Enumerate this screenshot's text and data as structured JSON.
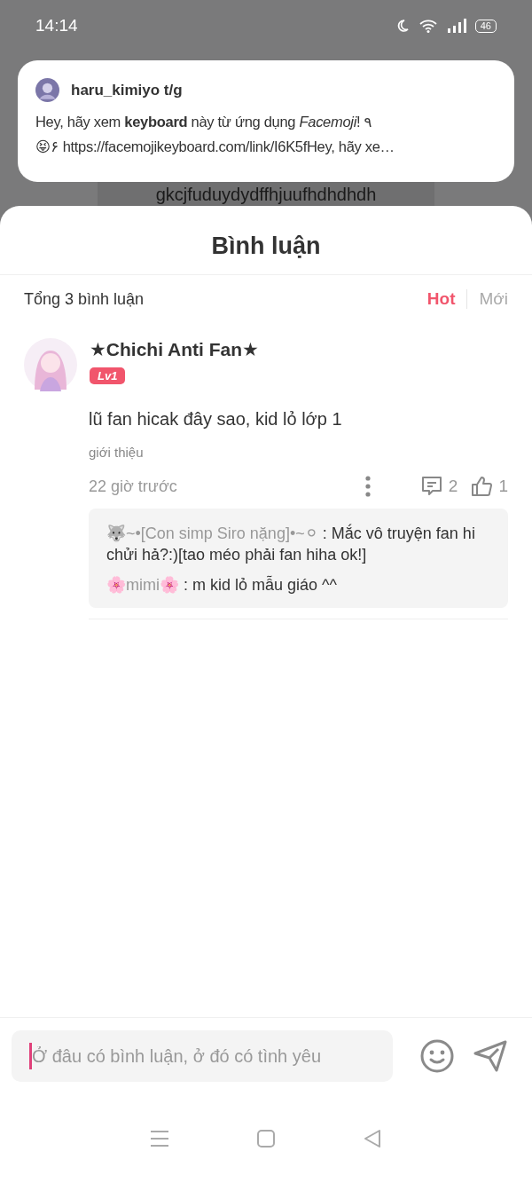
{
  "status_bar": {
    "time": "14:14",
    "battery": "46"
  },
  "background_text": "gkcjfuduydydffhjuufhdhdhdh",
  "notification": {
    "sender": "haru_kimiyo t/g",
    "message_lines": [
      "Hey, hãy xem **keyboard** này từ ứng dụng *Facemoji*! ٩",
      "😝۶ https://facemojikeyboard.com/link/I6K5fHey, hãy xe…"
    ]
  },
  "sheet": {
    "title": "Bình luận",
    "total": "Tổng 3 bình luận",
    "sort_tabs": [
      {
        "label": "Hot",
        "selected": true
      },
      {
        "label": "Mới",
        "selected": false
      }
    ]
  },
  "comments": [
    {
      "author": "★Chichi Anti Fan★",
      "level_badge": "Lv1",
      "text": "lũ fan hicak đây sao, kid lỏ lớp 1",
      "intro": "giới thiệu",
      "time": "22 giờ trước",
      "reply_count": "2",
      "like_count": "1",
      "replies": [
        {
          "name": "🐺~•[Con simp Siro nặng]•~⚪",
          "text": " : Mắc vô truyện fan hi chửi hả?:)[tao méo phải fan hiha ok!]"
        },
        {
          "name": "🌸mimi🌸",
          "text": " : m kid lỏ mẫu giáo ^^"
        }
      ]
    }
  ],
  "input": {
    "placeholder": "Ở đâu có bình luận, ở đó có tình yêu"
  }
}
